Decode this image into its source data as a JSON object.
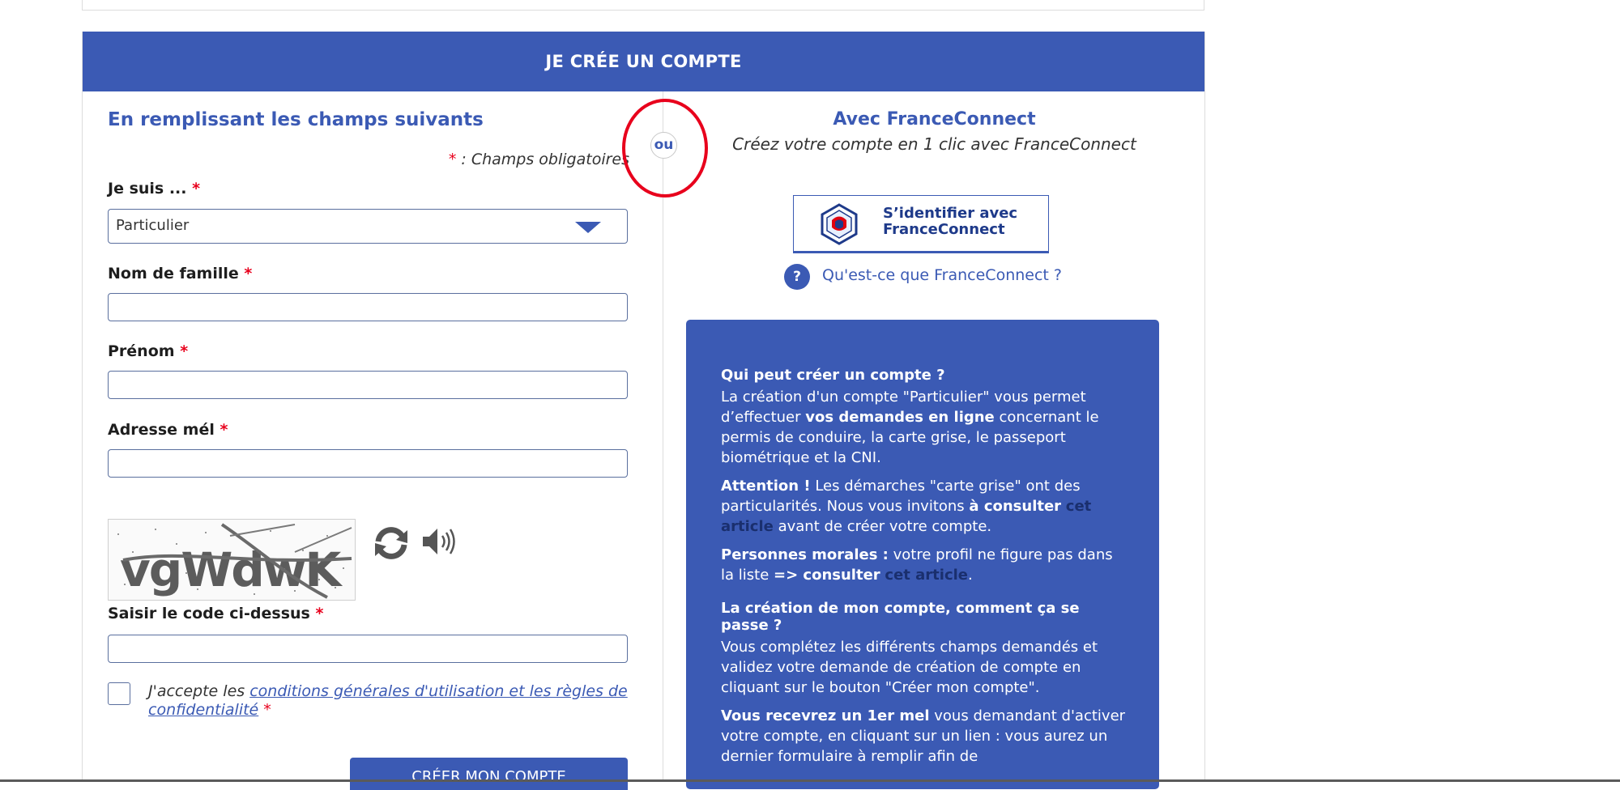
{
  "header": {
    "title": "JE CRÉE UN COMPTE"
  },
  "separator": {
    "label": "ou"
  },
  "left": {
    "title": "En remplissant les champs suivants",
    "mandatory_star": "*",
    "mandatory_note": " : Champs obligatoires",
    "fields": {
      "je_suis": {
        "label": "Je suis ...",
        "value": "Particulier"
      },
      "nom": {
        "label": "Nom de famille",
        "value": ""
      },
      "prenom": {
        "label": "Prénom",
        "value": ""
      },
      "email": {
        "label": "Adresse mél",
        "value": ""
      },
      "captcha": {
        "label": "Saisir le code ci-dessus",
        "value": "",
        "image_text": "vgWdwK"
      }
    },
    "required_star": "*",
    "cgu": {
      "prefix": "J'accepte les ",
      "link": "conditions générales d'utilisation et les règles de confidentialité",
      "suffix": " *"
    },
    "submit_label": "CRÉER MON COMPTE"
  },
  "right": {
    "title": "Avec FranceConnect",
    "subtitle": "Créez votre compte en 1 clic avec FranceConnect",
    "fc_button": {
      "line1": "S’identifier avec",
      "line2": "FranceConnect"
    },
    "help_icon": "?",
    "help_link": "Qu'est-ce que FranceConnect ?",
    "info": {
      "heading1": "Qui peut créer un compte ?",
      "p1_a": "La création d'un compte \"Particulier\" vous permet d’effectuer ",
      "p1_b": "vos demandes en ligne",
      "p1_c": " concernant le permis de conduire, la carte grise, le passeport biométrique et la CNI.",
      "p2_a": "Attention !",
      "p2_b": " Les démarches \"carte grise\" ont des particularités. Nous vous invitons ",
      "p2_c": "à consulter",
      "p2_link": "cet article",
      "p2_d": " avant de créer votre compte.",
      "p3_a": "Personnes morales :",
      "p3_b": " votre profil ne figure pas dans la liste ",
      "p3_c": "=> consulter",
      "p3_link": "cet article",
      "p3_d": ".",
      "heading2": "La création de mon compte, comment ça se passe ?",
      "p4": "Vous complétez les différents champs demandés et validez votre demande de création de compte en cliquant sur le bouton \"Créer mon compte\".",
      "p5_a": "Vous recevrez un 1er mel",
      "p5_b": " vous demandant d'activer votre compte, en cliquant sur un lien : vous aurez un dernier formulaire à remplir afin de"
    }
  },
  "colors": {
    "brand_blue": "#3b5ab4",
    "required_red": "#e8001c",
    "annotation_red": "#e8001c"
  }
}
